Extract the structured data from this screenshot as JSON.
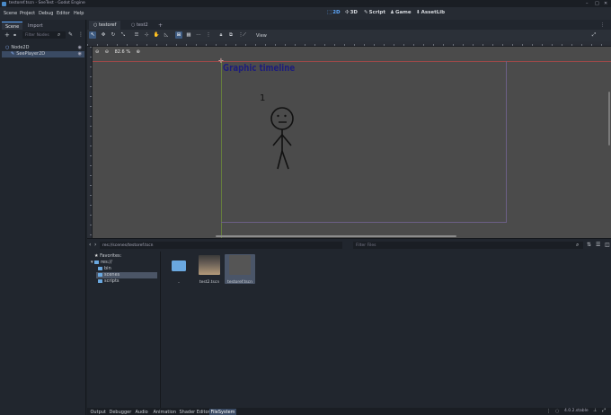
{
  "window": {
    "title": "testoref.tscn - SeeTest - Godot Engine"
  },
  "menus": [
    "Scene",
    "Project",
    "Debug",
    "Editor",
    "Help"
  ],
  "workspaces": [
    {
      "label": "2D",
      "icon": "2d-icon",
      "active": true
    },
    {
      "label": "3D",
      "icon": "3d-icon",
      "active": false
    },
    {
      "label": "Script",
      "icon": "script-icon",
      "active": false
    },
    {
      "label": "Game",
      "icon": "game-icon",
      "active": false
    },
    {
      "label": "AssetLib",
      "icon": "assetlib-icon",
      "active": false
    }
  ],
  "left_dock": {
    "tabs": [
      "Scene",
      "Import"
    ],
    "filter_placeholder": "Filter Nodes",
    "nodes": [
      {
        "label": "Node2D",
        "selected": false
      },
      {
        "label": "SeePlayer2D",
        "selected": true
      }
    ]
  },
  "scene_tabs": [
    "testoref",
    "test2"
  ],
  "toolbar": {
    "view_label": "View"
  },
  "viewport": {
    "zoom": "82.6 %",
    "canvas_title": "Graphic timeline",
    "marker_number": "1"
  },
  "filesystem": {
    "path": "res://scenes/testoref.tscn",
    "filter_placeholder": "Filter Files",
    "tree": [
      {
        "label": "Favorites:",
        "indent": 0,
        "selected": false,
        "icon": "star-icon"
      },
      {
        "label": "res://",
        "indent": 0,
        "selected": false,
        "icon": "folder-icon"
      },
      {
        "label": "bin",
        "indent": 1,
        "selected": false,
        "icon": "folder-icon"
      },
      {
        "label": "scenes",
        "indent": 1,
        "selected": true,
        "icon": "folder-icon"
      },
      {
        "label": "scripts",
        "indent": 1,
        "selected": false,
        "icon": "folder-icon"
      }
    ],
    "files": [
      {
        "label": "..",
        "kind": "folder",
        "selected": false
      },
      {
        "label": "test2.tscn",
        "kind": "scene-thumb",
        "selected": false
      },
      {
        "label": "testoref.tscn",
        "kind": "scene-dark",
        "selected": true
      }
    ]
  },
  "bottom_tabs": [
    {
      "label": "Output",
      "active": false
    },
    {
      "label": "Debugger",
      "active": false
    },
    {
      "label": "Audio",
      "active": false
    },
    {
      "label": "Animation",
      "active": false
    },
    {
      "label": "Shader Editor",
      "active": false
    },
    {
      "label": "FileSystem",
      "active": true
    }
  ],
  "version": "4.0.2.stable",
  "colors": {
    "accent": "#5ea9ff",
    "canvas_bg": "#4b4b4b",
    "title_text": "#1e1e7a"
  }
}
